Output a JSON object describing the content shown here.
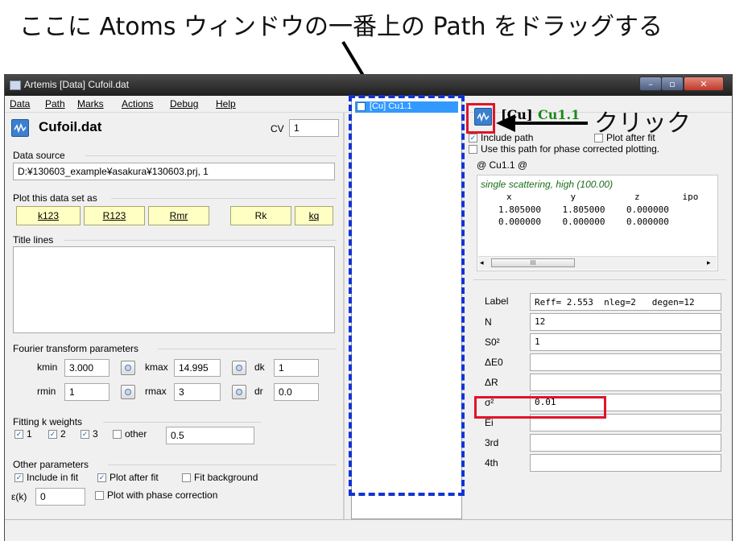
{
  "caption": "ここに Atoms ウィンドウの一番上の Path をドラッグする",
  "click_note": "クリック",
  "window": {
    "title": "Artemis [Data] Cufoil.dat",
    "min": "–",
    "max": "▫",
    "close": "✕"
  },
  "menu": [
    "Data",
    "Path",
    "Marks",
    "Actions",
    "Debug",
    "Help"
  ],
  "data_panel": {
    "file_name": "Cufoil.dat",
    "cv_label": "CV",
    "cv_value": "1",
    "data_source_label": "Data source",
    "data_source_value": "D:¥130603_example¥asakura¥130603.prj, 1",
    "plot_label": "Plot this data set as",
    "plot_buttons": [
      "k123",
      "R123",
      "Rmr",
      "Rk",
      "kq"
    ],
    "title_lines_label": "Title lines",
    "fourier_label": "Fourier transform parameters",
    "kmin_label": "kmin",
    "kmin_value": "3.000",
    "kmax_label": "kmax",
    "kmax_value": "14.995",
    "dk_label": "dk",
    "dk_value": "1",
    "rmin_label": "rmin",
    "rmin_value": "1",
    "rmax_label": "rmax",
    "rmax_value": "3",
    "dr_label": "dr",
    "dr_value": "0.0",
    "fitting_label": "Fitting k weights",
    "kw1": "1",
    "kw2": "2",
    "kw3": "3",
    "kw_other": "other",
    "kw_other_value": "0.5",
    "other_label": "Other parameters",
    "include_in_fit": "Include in fit",
    "plot_after_fit": "Plot after fit",
    "fit_background": "Fit background",
    "epsilon_label": "ε(k)",
    "epsilon_value": "0",
    "plot_phase": "Plot with phase correction"
  },
  "path_list": {
    "item": "[Cu]  Cu1.1"
  },
  "path_panel": {
    "title_prefix": "[Cu]",
    "title_name": "Cu1.1",
    "include_path": "Include path",
    "plot_after_fit": "Plot after fit",
    "phase_corrected": "Use this path for phase corrected plotting.",
    "feff_group": "@ Cu1.1  @",
    "feff_header": "single scattering, high (100.00)",
    "feff_cols": "x           y           z        ipo",
    "feff_row1": "1.805000    1.805000    0.000000",
    "feff_row2": "0.000000    0.000000    0.000000",
    "scroll_grip": "III",
    "label_label": "Label",
    "label_value": "Reff= 2.553  nleg=2   degen=12",
    "n_label": "N",
    "n_value": "12",
    "s02_label": "S0²",
    "s02_value": "1",
    "de0_label": "ΔE0",
    "de0_value": "",
    "dr_label": "ΔR",
    "dr_value": "",
    "sigma_label": "σ²",
    "sigma_value": "0.01",
    "ei_label": "Ei",
    "ei_value": "",
    "third_label": "3rd",
    "third_value": "",
    "fourth_label": "4th",
    "fourth_value": ""
  },
  "colors": {
    "annotation_blue": "#1233d4",
    "annotation_red": "#e0142a",
    "button_yellow": "#ffffc4",
    "path_name_green": "#1a8a1a",
    "selection_blue": "#3399ff"
  }
}
